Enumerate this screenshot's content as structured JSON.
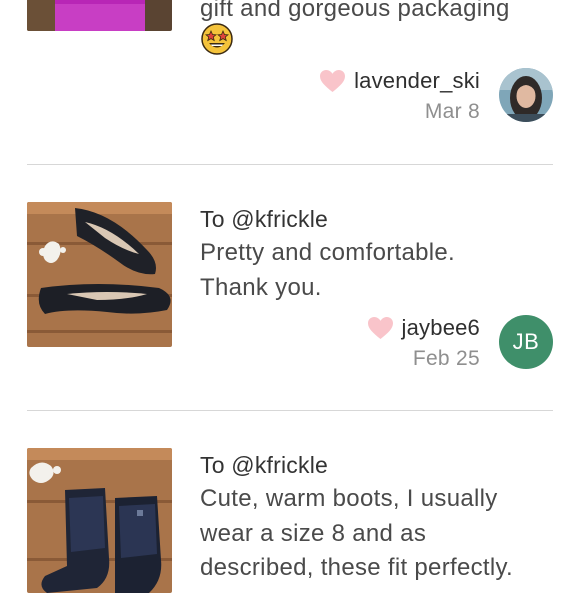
{
  "reviews": [
    {
      "to": "",
      "text": "gift and gorgeous packaging",
      "emoji": "star-struck-emoji",
      "username": "lavender_ski",
      "date": "Mar 8",
      "avatar_type": "photo",
      "avatar_initials": ""
    },
    {
      "to": "To @kfrickle",
      "text_lines": [
        "Pretty and comfortable.",
        "Thank you."
      ],
      "username": "jaybee6",
      "date": "Feb 25",
      "avatar_type": "initials",
      "avatar_initials": "JB",
      "avatar_color": "#3f8f6a"
    },
    {
      "to": "To @kfrickle",
      "text_lines": [
        "Cute, warm boots, I usually",
        "wear a size 8 and as",
        "described, these fit perfectly."
      ],
      "username": "",
      "date": ""
    }
  ],
  "colors": {
    "heart": "#f9c4ca",
    "divider": "#d7d7d7",
    "initials_avatar": "#3f8f6a"
  }
}
